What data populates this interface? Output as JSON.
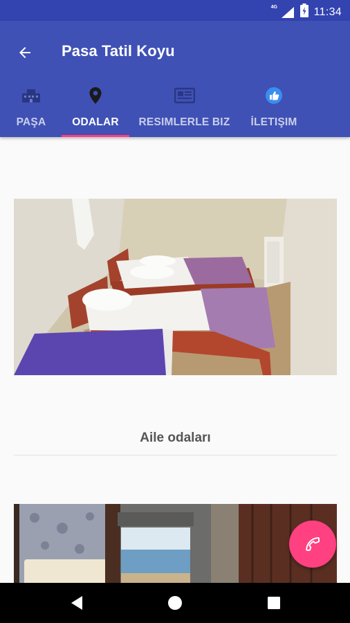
{
  "status_bar": {
    "time": "11:34",
    "network": "4G"
  },
  "app_bar": {
    "title": "Pasa Tatil Koyu"
  },
  "tabs": [
    {
      "label": "PAŞA",
      "icon": "hotel-icon"
    },
    {
      "label": "ODALAR",
      "icon": "location-pin-icon",
      "active": true
    },
    {
      "label": "RESIMLERLE BIZ",
      "icon": "newspaper-icon"
    },
    {
      "label": "İLETIŞIM",
      "icon": "thumbs-up-icon"
    }
  ],
  "content": {
    "rooms": [
      {
        "caption": "Aile odaları"
      }
    ]
  },
  "fab": {
    "icon": "phone-icon"
  },
  "colors": {
    "primary": "#3f51b5",
    "primary_dark": "#3343b0",
    "accent": "#ff4081"
  }
}
